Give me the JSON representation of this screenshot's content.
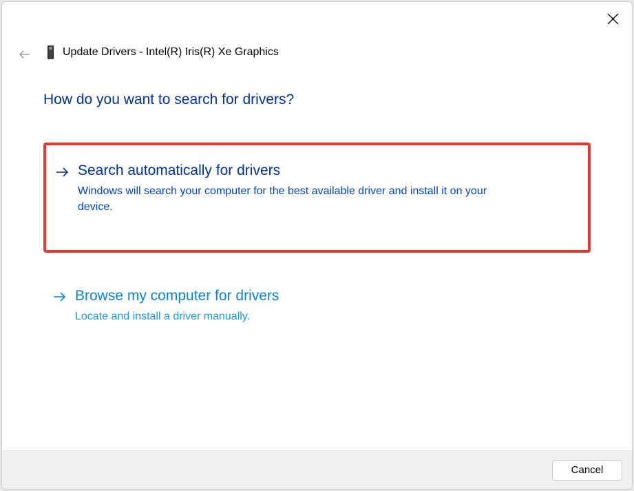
{
  "window": {
    "title": "Update Drivers - Intel(R) Iris(R) Xe Graphics"
  },
  "heading": "How do you want to search for drivers?",
  "options": [
    {
      "title": "Search automatically for drivers",
      "description": "Windows will search your computer for the best available driver and install it on your device.",
      "highlighted": true
    },
    {
      "title": "Browse my computer for drivers",
      "description": "Locate and install a driver manually.",
      "highlighted": false
    }
  ],
  "buttons": {
    "cancel": "Cancel"
  }
}
